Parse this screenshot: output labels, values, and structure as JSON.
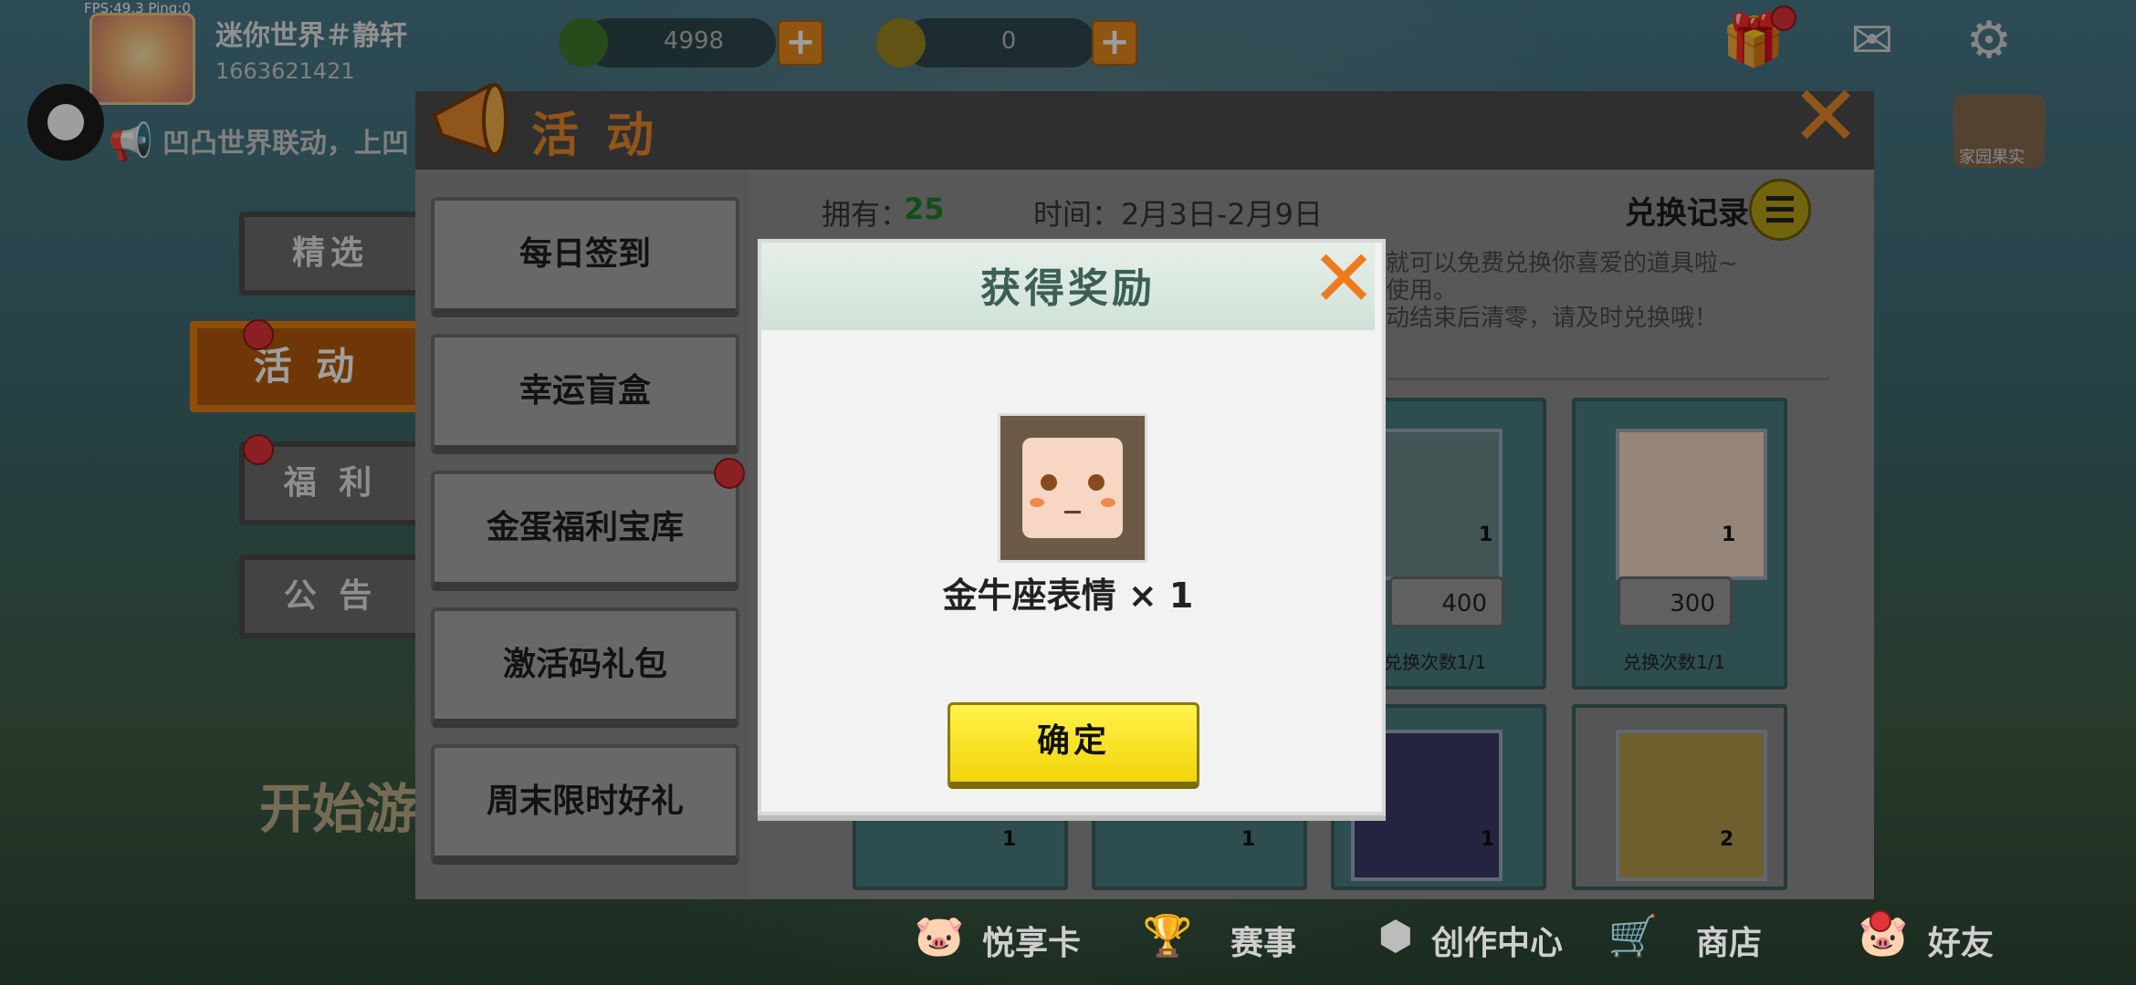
{
  "hud": {
    "fps": "FPS:49.3  Ping:0"
  },
  "user": {
    "name": "迷你世界＃静轩",
    "id": "1663621421"
  },
  "resources": [
    {
      "value": "4998",
      "icon": "mini-bean-icon"
    },
    {
      "value": "0",
      "icon": "mini-coin-icon"
    }
  ],
  "marquee": "凹凸世界联动，上凹",
  "left_tabs": [
    {
      "label": "精选"
    },
    {
      "label": "活 动"
    },
    {
      "label": "福 利"
    },
    {
      "label": "公 告"
    }
  ],
  "start_game": "开始游",
  "panel": {
    "title": "活 动",
    "menu": [
      {
        "label": "每日签到"
      },
      {
        "label": "幸运盲盒"
      },
      {
        "label": "金蛋福利宝库"
      },
      {
        "label": "激活码礼包"
      },
      {
        "label": "周末限时好礼"
      }
    ],
    "own_label": "拥有：",
    "own_value": "25",
    "time": "时间：2月3日-2月9日",
    "record": "兑换记录",
    "desc": [
      "就可以免费兑换你喜爱的道具啦~",
      "使用。",
      "动结束后清零，请及时兑换哦！"
    ],
    "cards": [
      {
        "qty": "1",
        "price": "400",
        "times": "兑换次数1/1"
      },
      {
        "qty": "1",
        "price": "300",
        "times": "兑换次数1/1"
      },
      {
        "qty": "1"
      },
      {
        "qty": "1"
      },
      {
        "qty": "1"
      },
      {
        "qty": "2"
      }
    ]
  },
  "modal": {
    "title": "获得奖励",
    "reward": "金牛座表情 × 1",
    "ok": "确定"
  },
  "bottom_nav": [
    {
      "label": "悦享卡"
    },
    {
      "label": "赛事"
    },
    {
      "label": "创作中心"
    },
    {
      "label": "商店"
    },
    {
      "label": "好友"
    }
  ],
  "top_banner": [
    "家园果实"
  ]
}
